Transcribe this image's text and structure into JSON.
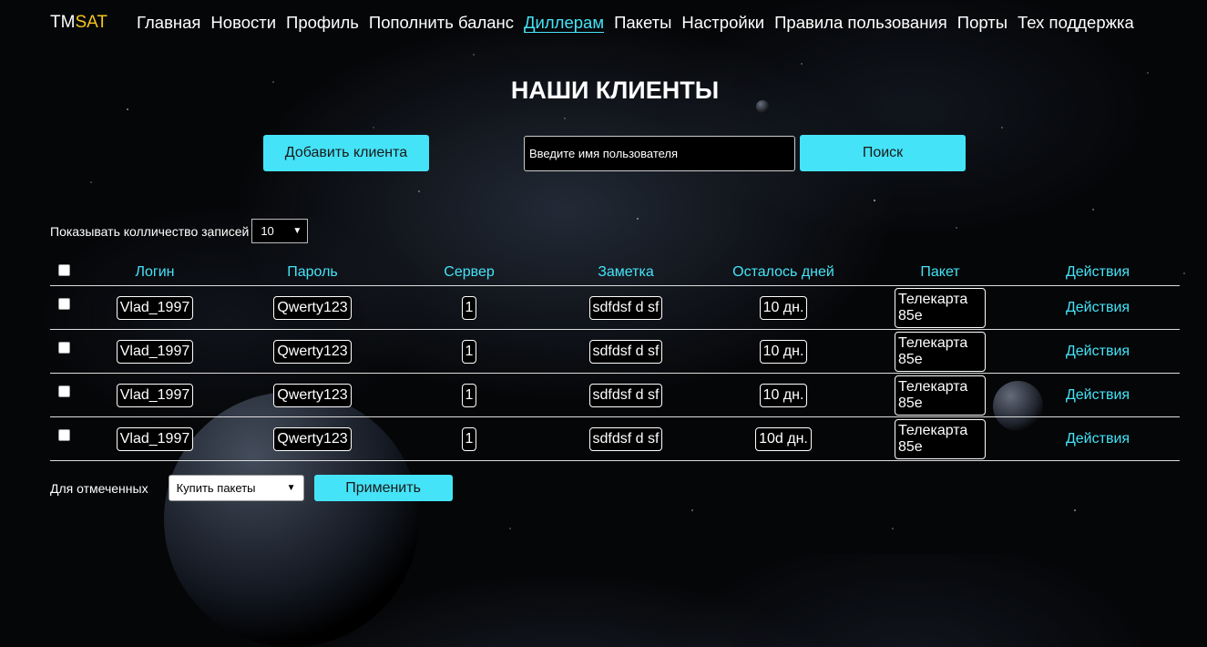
{
  "nav": {
    "logo_tm": "TM",
    "logo_sat": "SAT",
    "items": [
      "Главная",
      "Новости",
      "Профиль",
      "Пополнить баланс",
      "Диллерам",
      "Пакеты",
      "Настройки",
      "Правила пользования",
      "Порты",
      "Тех поддержка"
    ],
    "active": "Диллерам"
  },
  "title": "НАШИ КЛИЕНТЫ",
  "add_client_label": "Добавить клиента",
  "search": {
    "placeholder": "Введите имя пользователя",
    "button_label": "Поиск"
  },
  "records": {
    "label": "Показывать колличество записей",
    "value": "10"
  },
  "table": {
    "headers": {
      "login": "Логин",
      "password": "Пароль",
      "server": "Сервер",
      "note": "Заметка",
      "days": "Осталось дней",
      "package": "Пакет",
      "actions": "Действия"
    },
    "rows": [
      {
        "login": "Vlad_1997",
        "password": "Qwerty123",
        "server": "1",
        "note": "sdfdsf d sf",
        "days": "10 дн.",
        "package": "Телекарта 85е",
        "actions": "Действия"
      },
      {
        "login": "Vlad_1997",
        "password": "Qwerty123",
        "server": "1",
        "note": "sdfdsf d sf",
        "days": "10 дн.",
        "package": "Телекарта 85е",
        "actions": "Действия"
      },
      {
        "login": "Vlad_1997",
        "password": "Qwerty123",
        "server": "1",
        "note": "sdfdsf d sf",
        "days": "10 дн.",
        "package": "Телекарта 85е",
        "actions": "Действия"
      },
      {
        "login": "Vlad_1997",
        "password": "Qwerty123",
        "server": "1",
        "note": "sdfdsf d sf",
        "days": "10d дн.",
        "package": "Телекарта 85е",
        "actions": "Действия"
      }
    ]
  },
  "bulk": {
    "label": "Для отмеченных",
    "select_value": "Купить пакеты",
    "apply_label": "Применить"
  },
  "colors": {
    "accent": "#45e3f7",
    "logo_accent": "#f5c518",
    "background": "#050608"
  }
}
